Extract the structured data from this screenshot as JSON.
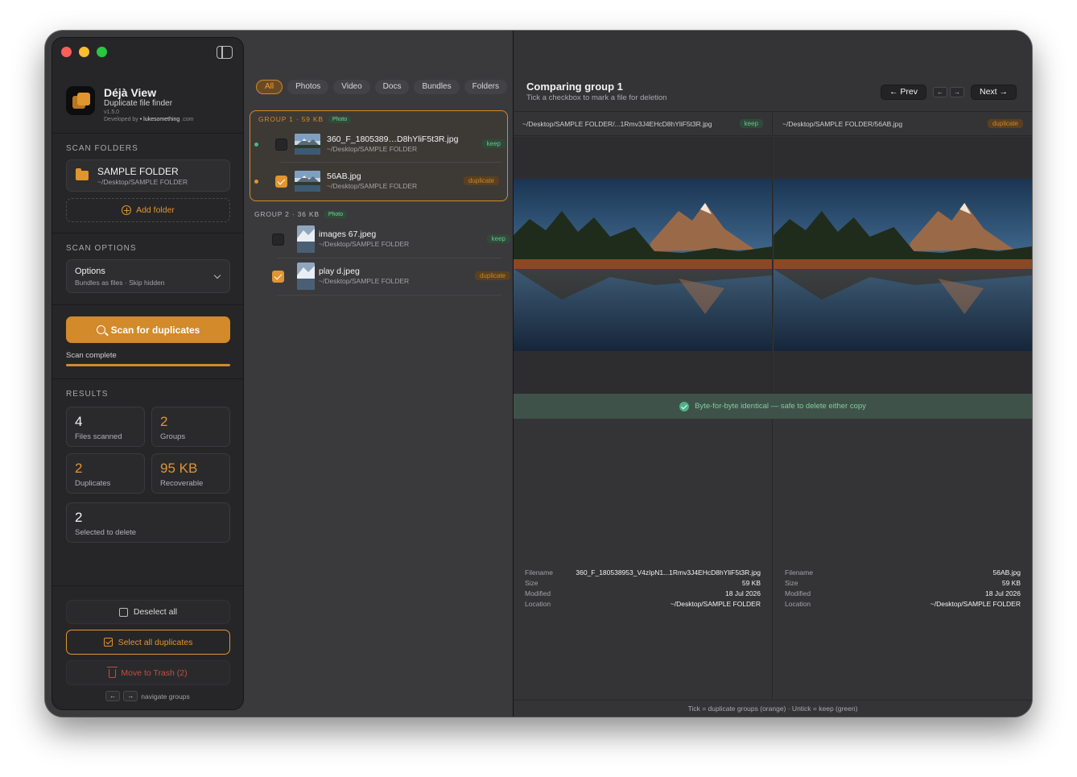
{
  "app": {
    "name": "Déjà View",
    "subtitle": "Duplicate file finder",
    "version": "v1.5.0",
    "developed_by": "Developed by",
    "developer": "• lukesomething",
    "developer_domain": ".com"
  },
  "sidebar": {
    "scan_folders_title": "SCAN FOLDERS",
    "folder": {
      "name": "SAMPLE FOLDER",
      "path": "~/Desktop/SAMPLE FOLDER"
    },
    "add_folder": "Add folder",
    "scan_options_title": "SCAN OPTIONS",
    "options": {
      "label": "Options",
      "summary": "Bundles as files · Skip hidden"
    },
    "scan_button": "Scan for duplicates",
    "scan_status": "Scan complete",
    "scan_progress": 1.0,
    "results_title": "RESULTS",
    "stats": {
      "files_scanned": {
        "value": "4",
        "label": "Files scanned"
      },
      "groups": {
        "value": "2",
        "label": "Groups"
      },
      "duplicates": {
        "value": "2",
        "label": "Duplicates"
      },
      "recoverable": {
        "value": "95 KB",
        "label": "Recoverable"
      },
      "selected": {
        "value": "2",
        "label": "Selected to delete"
      }
    },
    "deselect_all": "Deselect all",
    "select_all_duplicates": "Select all duplicates",
    "move_to_trash": "Move to Trash (2)",
    "nav_left_key": "←",
    "nav_right_key": "→",
    "nav_hint": "navigate groups"
  },
  "filters": [
    "All",
    "Photos",
    "Video",
    "Docs",
    "Bundles",
    "Folders"
  ],
  "active_filter": "All",
  "groups": [
    {
      "header": "GROUP 1 · 59 KB",
      "tag": "Photo",
      "files": [
        {
          "name": "360_F_1805389…D8hYliF5t3R.jpg",
          "path": "~/Desktop/SAMPLE FOLDER",
          "badge": "keep",
          "checked": false
        },
        {
          "name": "56AB.jpg",
          "path": "~/Desktop/SAMPLE FOLDER",
          "badge": "duplicate",
          "checked": true
        }
      ]
    },
    {
      "header": "GROUP 2 · 36 KB",
      "tag": "Photo",
      "files": [
        {
          "name": "images 67.jpeg",
          "path": "~/Desktop/SAMPLE FOLDER",
          "badge": "keep",
          "checked": false
        },
        {
          "name": "play d.jpeg",
          "path": "~/Desktop/SAMPLE FOLDER",
          "badge": "duplicate",
          "checked": true
        }
      ]
    }
  ],
  "compare": {
    "title": "Comparing group 1",
    "subtitle": "Tick a checkbox to mark a file for deletion",
    "prev": "← Prev",
    "key_left": "←",
    "key_right": "→",
    "next": "Next →",
    "left": {
      "path": "~/Desktop/SAMPLE FOLDER/...1Rmv3J4EHcD8hYliF5t3R.jpg",
      "badge": "keep",
      "filename_label": "Filename",
      "filename": "360_F_180538953_V4zIpN1...1Rmv3J4EHcD8hYliF5t3R.jpg",
      "size_label": "Size",
      "size": "59 KB",
      "modified_label": "Modified",
      "modified": "18 Jul 2026",
      "location_label": "Location",
      "location": "~/Desktop/SAMPLE FOLDER"
    },
    "right": {
      "path": "~/Desktop/SAMPLE FOLDER/56AB.jpg",
      "badge": "duplicate",
      "filename_label": "Filename",
      "filename": "56AB.jpg",
      "size_label": "Size",
      "size": "59 KB",
      "modified_label": "Modified",
      "modified": "18 Jul 2026",
      "location_label": "Location",
      "location": "~/Desktop/SAMPLE FOLDER"
    },
    "identical_msg": "Byte-for-byte identical — safe to delete either copy",
    "footer": "Tick = duplicate groups (orange) · Untick = keep (green)"
  },
  "colors": {
    "accent": "#d28a2a",
    "keep": "#4cb38a",
    "danger": "#c0503f"
  }
}
